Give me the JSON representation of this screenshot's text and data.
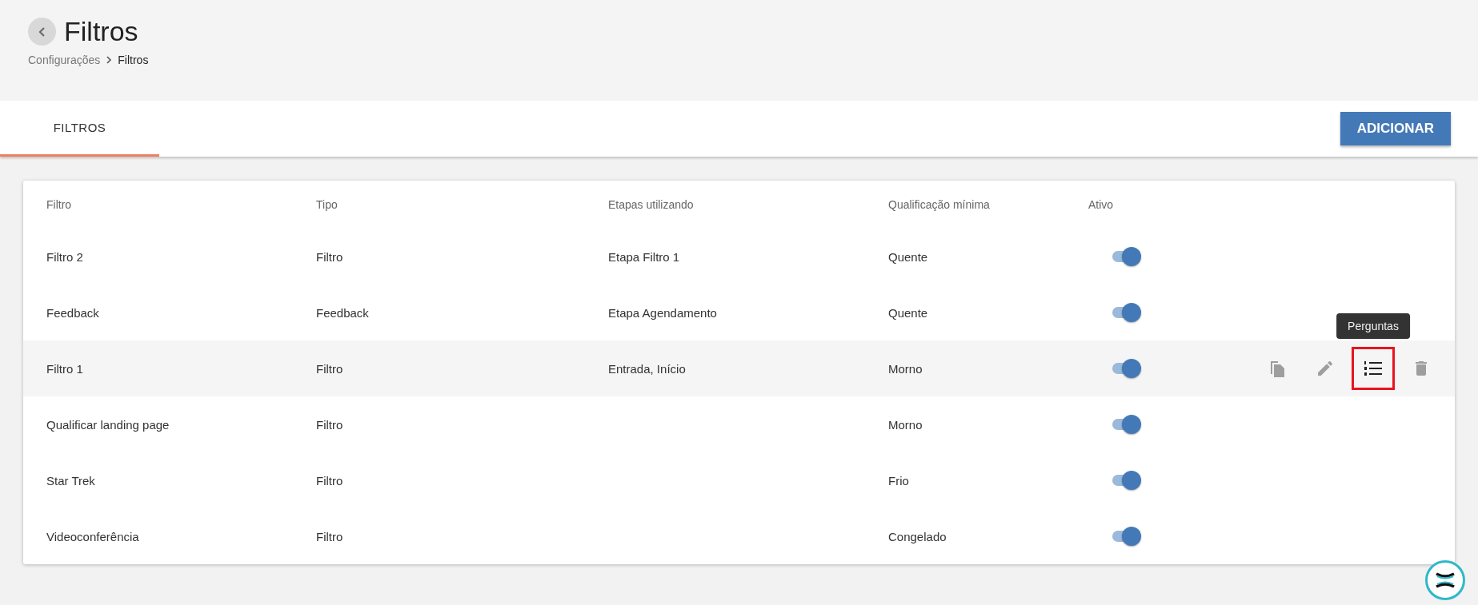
{
  "header": {
    "title": "Filtros",
    "breadcrumb": [
      {
        "label": "Configurações",
        "current": false
      },
      {
        "label": "Filtros",
        "current": true
      }
    ]
  },
  "tabs": [
    {
      "label": "FILTROS",
      "selected": true
    }
  ],
  "add_button": "ADICIONAR",
  "table": {
    "columns": [
      "Filtro",
      "Tipo",
      "Etapas utilizando",
      "Qualificação mínima",
      "Ativo"
    ],
    "rows": [
      {
        "filtro": "Filtro 2",
        "tipo": "Filtro",
        "etapas": "Etapa Filtro 1",
        "qualificacao": "Quente",
        "ativo": true,
        "hovered": false
      },
      {
        "filtro": "Feedback",
        "tipo": "Feedback",
        "etapas": "Etapa Agendamento",
        "qualificacao": "Quente",
        "ativo": true,
        "hovered": false
      },
      {
        "filtro": "Filtro 1",
        "tipo": "Filtro",
        "etapas": "Entrada, Início",
        "qualificacao": "Morno",
        "ativo": true,
        "hovered": true,
        "actions": [
          {
            "kind": "copy",
            "highlighted": false
          },
          {
            "kind": "edit",
            "highlighted": false
          },
          {
            "kind": "questions",
            "highlighted": true,
            "tooltip": "Perguntas"
          },
          {
            "kind": "delete",
            "highlighted": false
          }
        ]
      },
      {
        "filtro": "Qualificar landing page",
        "tipo": "Filtro",
        "qualificacao": "Morno",
        "ativo": true,
        "hovered": false
      },
      {
        "filtro": "Star Trek",
        "tipo": "Filtro",
        "qualificacao": "Frio",
        "ativo": true,
        "hovered": false
      },
      {
        "filtro": "Videoconferência",
        "tipo": "Filtro",
        "qualificacao": "Congelado",
        "ativo": true,
        "hovered": false
      }
    ]
  }
}
